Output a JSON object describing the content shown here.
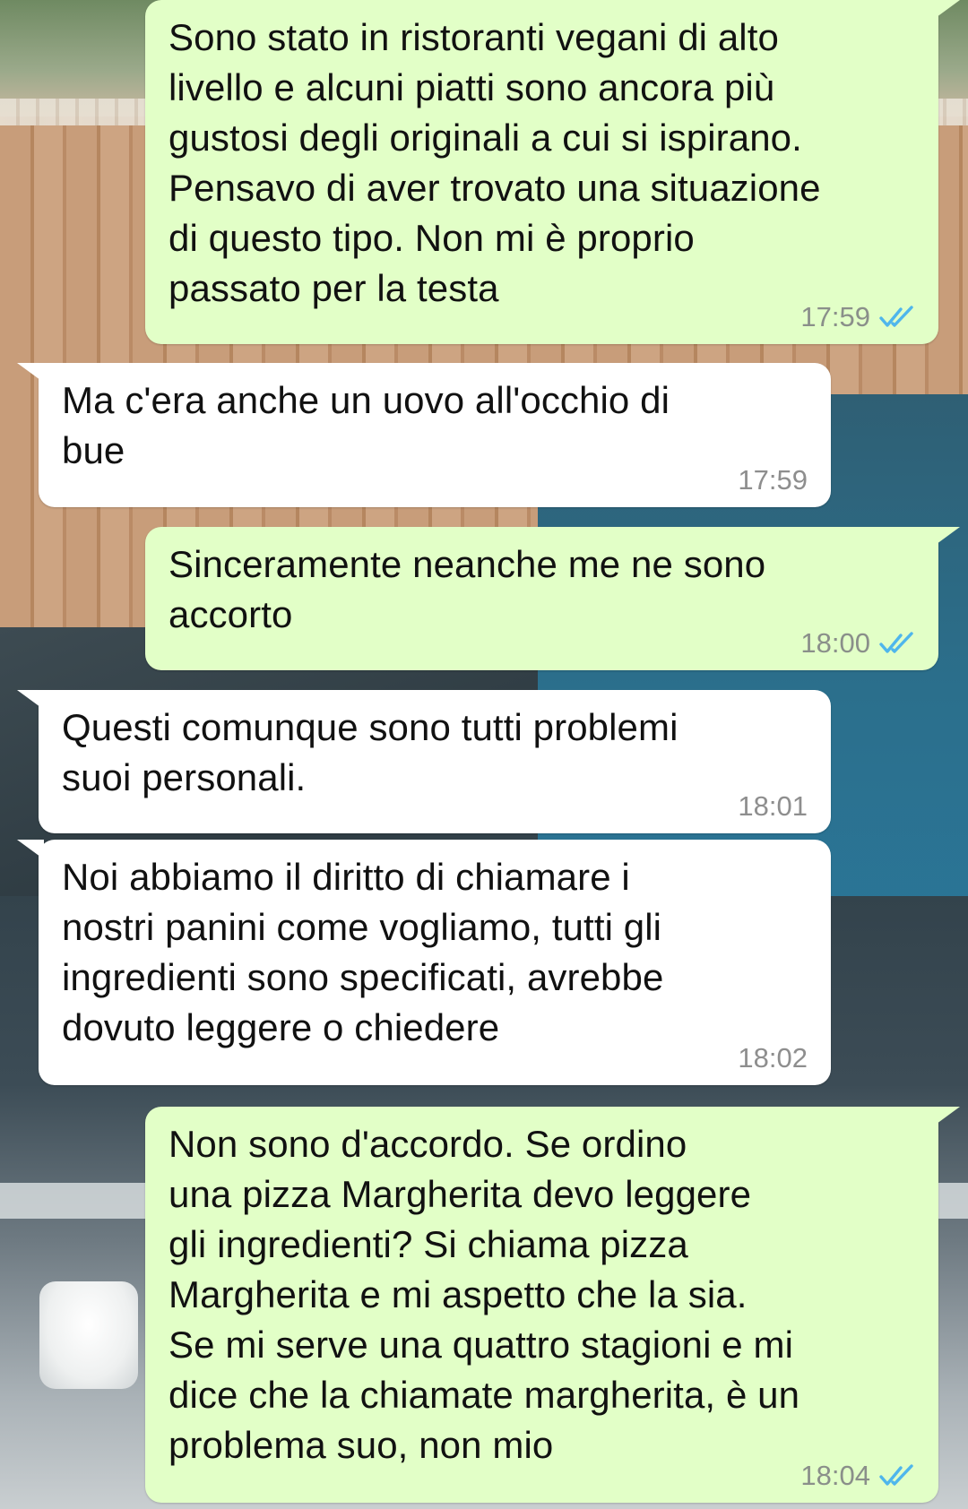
{
  "colors": {
    "outgoing_bubble": "#e2ffc7",
    "incoming_bubble": "#ffffff",
    "read_ticks": "#4fb6ec",
    "timestamp": "#8a8f8a"
  },
  "messages": [
    {
      "direction": "outgoing",
      "text": "Sono stato in ristoranti vegani di alto\nlivello e alcuni piatti sono ancora più\ngustosi degli originali a cui si ispirano.\nPensavo di aver trovato una situazione\ndi questo tipo. Non mi è proprio\npassato per la testa",
      "time": "17:59",
      "status_icon": "double-check-read-icon"
    },
    {
      "direction": "incoming",
      "text": "Ma c'era anche un uovo all'occhio di\nbue",
      "time": "17:59"
    },
    {
      "direction": "outgoing",
      "text": "Sinceramente neanche me ne sono\naccorto",
      "time": "18:00",
      "status_icon": "double-check-read-icon"
    },
    {
      "direction": "incoming",
      "text": "Questi comunque sono tutti problemi\nsuoi personali.",
      "time": "18:01"
    },
    {
      "direction": "incoming",
      "text": "Noi abbiamo il diritto di chiamare i\nnostri panini come vogliamo, tutti gli\ningredienti sono specificati, avrebbe\ndovuto leggere o chiedere",
      "time": "18:02"
    },
    {
      "direction": "outgoing",
      "text": "Non sono d'accordo. Se ordino\nuna pizza Margherita devo leggere\ngli ingredienti? Si chiama pizza\nMargherita e mi aspetto che la sia.\nSe mi serve una quattro stagioni e mi\ndice che la chiamate margherita, è un\nproblema suo, non mio",
      "time": "18:04",
      "status_icon": "double-check-read-icon"
    }
  ]
}
